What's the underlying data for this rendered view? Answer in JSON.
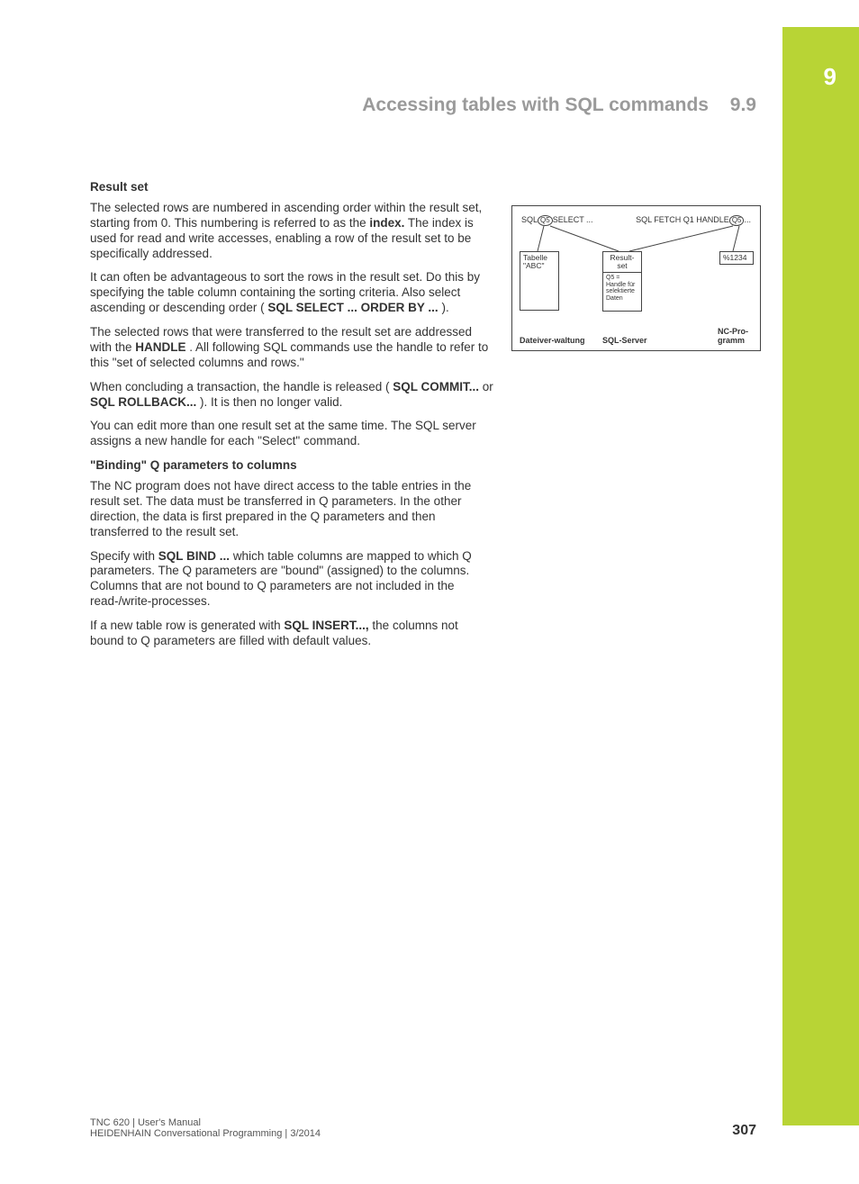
{
  "chapter": {
    "number": "9"
  },
  "header": {
    "title": "Accessing tables with SQL commands",
    "section": "9.9"
  },
  "section1": {
    "heading": "Result set",
    "p1_a": "The selected rows are numbered in ascending order within the result set, starting from 0. This numbering is referred to as the ",
    "p1_b": "index.",
    "p1_c": " The index is used for read and write accesses, enabling a row of the result set to be specifically addressed.",
    "p2_a": "It can often be advantageous to sort the rows in the result set. Do this by specifying the table column containing the sorting criteria. Also select ascending or descending order (",
    "p2_b": "SQL SELECT ... ORDER BY ...",
    "p2_c": ").",
    "p3_a": "The selected rows that were transferred to the result set are addressed with the ",
    "p3_b": "HANDLE",
    "p3_c": ". All following SQL commands use the handle to refer to this \"set of selected columns and rows.\"",
    "p4_a": "When concluding a transaction, the handle is released (",
    "p4_b": "SQL COMMIT...",
    "p4_c": " or ",
    "p4_d": "SQL ROLLBACK...",
    "p4_e": "). It is then no longer valid.",
    "p5": "You can edit more than one result set at the same time. The SQL server assigns a new handle for each \"Select\" command."
  },
  "section2": {
    "heading": "\"Binding\" Q parameters to columns",
    "p1": "The NC program does not have direct access to the table entries in the result set. The data must be transferred in Q parameters. In the other direction, the data is first prepared in the Q parameters and then transferred to the result set.",
    "p2_a": "Specify with ",
    "p2_b": "SQL BIND ...",
    "p2_c": " which table columns are mapped to which Q parameters. The Q parameters are \"bound\" (assigned) to the columns. Columns that are not bound to Q parameters are not included in the read-/write-processes.",
    "p3_a": "If a new table row is generated with ",
    "p3_b": "SQL INSERT...,",
    "p3_c": " the columns not bound to Q parameters are filled with default values."
  },
  "diagram": {
    "top_left_pre": "SQL",
    "top_left_mid": "Q5",
    "top_left_post": "SELECT ...",
    "top_right_pre": "SQL FETCH Q1 HANDLE",
    "top_right_mid": "Q5",
    "top_right_post": "...",
    "tabelle": "Tabelle \"ABC\"",
    "resultset": "Result-set",
    "handle": "Q5 = Handle für selektierte Daten",
    "prog": "%1234",
    "cap_left": "Dateiver-waltung",
    "cap_mid": "SQL-Server",
    "cap_right": "NC-Pro-gramm"
  },
  "footer": {
    "line1": "TNC 620 | User's Manual",
    "line2": "HEIDENHAIN Conversational Programming | 3/2014",
    "page": "307"
  }
}
